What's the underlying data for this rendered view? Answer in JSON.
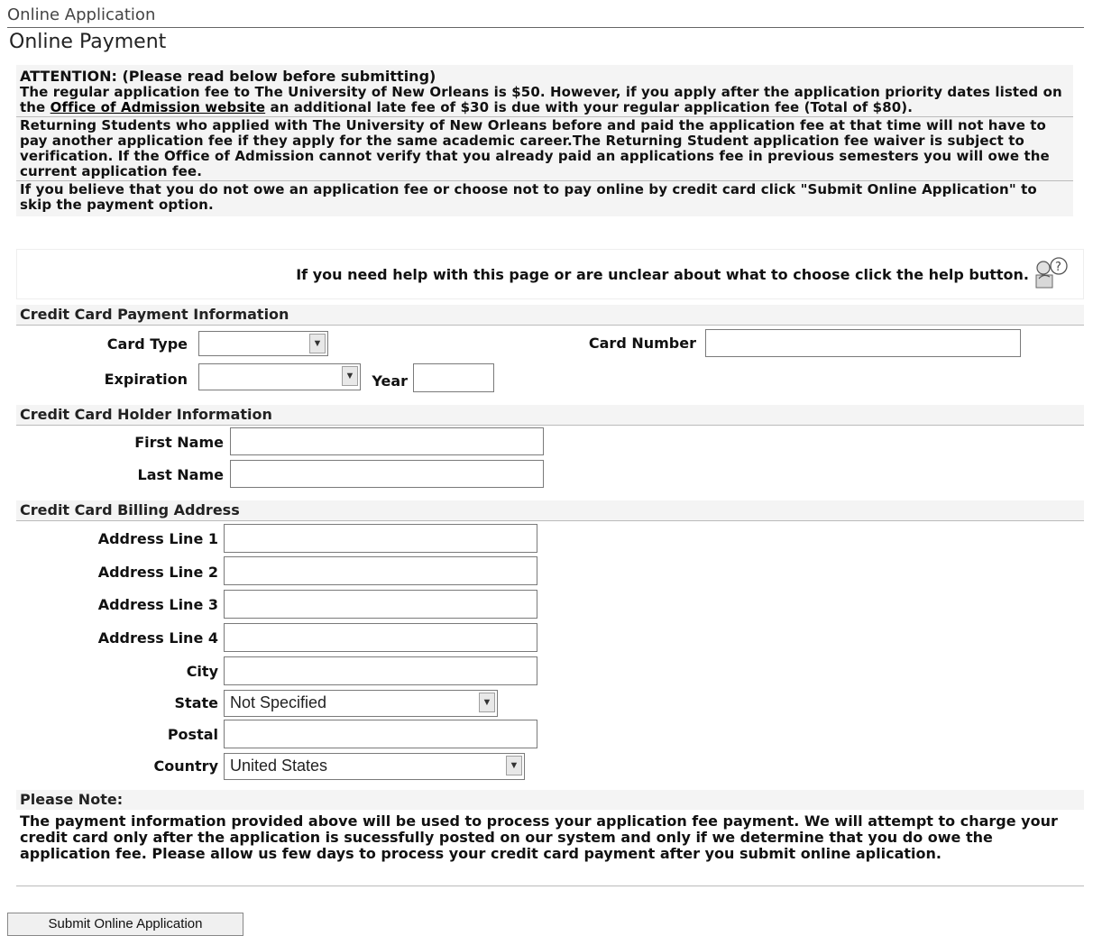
{
  "header": {
    "breadcrumb": "Online Application",
    "title": "Online Payment"
  },
  "attention": {
    "heading": "ATTENTION: (Please read below before submitting)",
    "p1_before_link": "The regular application fee to The University of New Orleans is $50. However, if you apply after the application priority dates listed on the ",
    "p1_link": "Office of Admission website",
    "p1_after_link": " an additional late fee of $30 is due with your regular application fee (Total of $80).",
    "p2": "Returning Students who applied with The University of New Orleans before and paid the application fee at that time will not have to pay another application fee if they apply for the same academic career.The Returning Student application fee waiver is subject to verification. If the Office of Admission cannot verify that you already paid an applications fee in previous semesters you will owe the current application fee.",
    "p3": "If you believe that you do not owe an application fee or choose not to pay online by credit card click \"Submit Online Application\" to skip the payment option."
  },
  "help": {
    "text": "If you need help with this page or are unclear about what to choose click the help button."
  },
  "credit_card": {
    "section_title": "Credit Card Payment Information",
    "card_type_label": "Card Type",
    "card_type_value": "",
    "card_number_label": "Card Number",
    "card_number_value": "",
    "expiration_label": "Expiration",
    "expiration_value": "",
    "year_label": "Year",
    "year_value": ""
  },
  "holder": {
    "section_title": "Credit Card Holder Information",
    "first_name_label": "First Name",
    "first_name_value": "",
    "last_name_label": "Last Name",
    "last_name_value": ""
  },
  "billing": {
    "section_title": "Credit Card Billing Address",
    "address1_label": "Address Line 1",
    "address2_label": "Address Line 2",
    "address3_label": "Address Line 3",
    "address4_label": "Address Line 4",
    "city_label": "City",
    "state_label": "State",
    "state_value": "Not Specified",
    "postal_label": "Postal",
    "country_label": "Country",
    "country_value": "United States"
  },
  "note": {
    "heading": "Please Note:",
    "text": "The payment information provided above will be used to process your application fee payment. We will attempt to charge your credit card only after the application is sucessfully posted on our system and only if we determine that you do owe the application fee. Please allow us few days to process your credit card payment after you submit online aplication."
  },
  "actions": {
    "submit_label": "Submit Online Application"
  }
}
